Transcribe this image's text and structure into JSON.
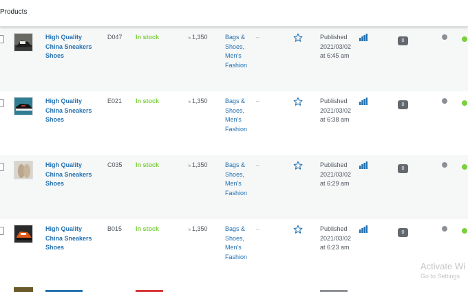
{
  "header": {
    "title": "Products"
  },
  "rows": [
    {
      "name": "High Quality China Sneakers Shoes",
      "sku": "D047",
      "stock": "In stock",
      "currency": "৳",
      "price": "1,350",
      "categories": "Bags & Shoes, Men's Fashion",
      "tags": "–",
      "status": "Published",
      "date": "2021/03/02 at 6:45 am",
      "count": "0"
    },
    {
      "name": "High Quality China Sneakers Shoes",
      "sku": "E021",
      "stock": "In stock",
      "currency": "৳",
      "price": "1,350",
      "categories": "Bags & Shoes, Men's Fashion",
      "tags": "–",
      "status": "Published",
      "date": "2021/03/02 at 6:38 am",
      "count": "0"
    },
    {
      "name": "High Quality China Sneakers Shoes",
      "sku": "C035",
      "stock": "In stock",
      "currency": "৳",
      "price": "1,350",
      "categories": "Bags & Shoes, Men's Fashion",
      "tags": "–",
      "status": "Published",
      "date": "2021/03/02 at 6:29 am",
      "count": "0"
    },
    {
      "name": "High Quality China Sneakers Shoes",
      "sku": "B015",
      "stock": "In stock",
      "currency": "৳",
      "price": "1,350",
      "categories": "Bags & Shoes, Men's Fashion",
      "tags": "–",
      "status": "Published",
      "date": "2021/03/02 at 6:23 am",
      "count": "0"
    }
  ],
  "watermark": {
    "line1": "Activate Wi",
    "line2": "Go to Settings"
  },
  "colors": {
    "link": "#2271b1",
    "in_stock": "#7ad03a",
    "badge": "#646970"
  },
  "icons": [
    "checkbox",
    "product-thumbnail",
    "star-icon",
    "stats-bars-icon",
    "status-dot"
  ]
}
